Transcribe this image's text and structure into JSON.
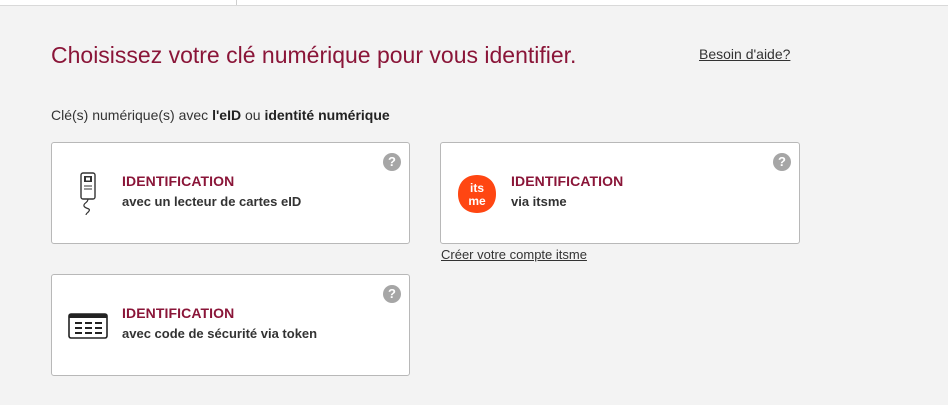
{
  "header": {
    "title": "Choisissez votre clé numérique pour vous identifier.",
    "help_link": "Besoin d'aide?"
  },
  "subtitle": {
    "prefix": "Clé(s) numérique(s) avec ",
    "eid": "l'eID",
    "middle": " ou ",
    "digital_identity": "identité numérique"
  },
  "options": [
    {
      "title": "IDENTIFICATION",
      "description": "avec un lecteur de cartes eID",
      "icon": "card-reader-icon",
      "help": "?"
    },
    {
      "title": "IDENTIFICATION",
      "description": "via itsme",
      "icon": "itsme-logo",
      "help": "?",
      "logo_text_top": "its",
      "logo_text_bottom": "me"
    },
    {
      "title": "IDENTIFICATION",
      "description": "avec code de sécurité via token",
      "icon": "token-icon",
      "help": "?"
    }
  ],
  "create_account_link": "Créer votre compte itsme",
  "colors": {
    "accent": "#8a1538",
    "itsme": "#ff4612",
    "background": "#f3f3f3",
    "card_border": "#b8b8b8",
    "help_icon": "#a6a6a6"
  }
}
